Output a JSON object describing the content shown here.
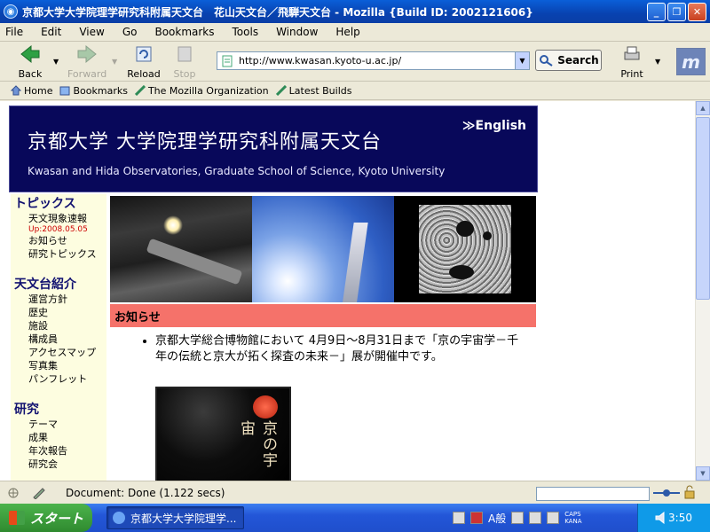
{
  "window": {
    "title": "京都大学大学院理学研究科附属天文台　花山天文台／飛騨天文台 - Mozilla {Build ID: 2002121606}",
    "buttons": [
      "_",
      "❐",
      "✕"
    ]
  },
  "menu": [
    "File",
    "Edit",
    "View",
    "Go",
    "Bookmarks",
    "Tools",
    "Window",
    "Help"
  ],
  "nav": {
    "back": "Back",
    "forward": "Forward",
    "reload": "Reload",
    "stop": "Stop",
    "url": "http://www.kwasan.kyoto-u.ac.jp/",
    "search": "Search",
    "print": "Print",
    "logo_letter": "m"
  },
  "personal_toolbar": [
    "Home",
    "Bookmarks",
    "The Mozilla Organization",
    "Latest Builds"
  ],
  "page": {
    "banner_jp": "京都大学 大学院理学研究科附属天文台",
    "banner_en": "Kwasan and Hida Observatories, Graduate School of Science, Kyoto University",
    "english_link": "≫English",
    "sidebar": [
      {
        "heading": "トピックス",
        "links": [
          "天文現象速報"
        ],
        "update": "Up:2008.05.05",
        "links2": [
          "お知らせ",
          "研究トピックス"
        ]
      },
      {
        "heading": "天文台紹介",
        "links": [
          "運営方針",
          "歴史",
          "施設",
          "構成員",
          "アクセスマップ",
          "写真集",
          "パンフレット"
        ]
      },
      {
        "heading": "研究",
        "links": [
          "テーマ",
          "成果",
          "年次報告",
          "研究会"
        ]
      }
    ],
    "news_heading": "お知らせ",
    "news_items": [
      "京都大学総合博物館において 4月9日～8月31日まで「京の宇宙学－千年の伝統と京大が拓く探査の未来－」展が開催中です。"
    ],
    "poster_text": "京の宇宙"
  },
  "status": {
    "message": "Document: Done (1.122 secs)"
  },
  "taskbar": {
    "start": "スタート",
    "task": "京都大学大学院理学...",
    "ime": "A般",
    "caps": "CAPS",
    "kana": "KANA",
    "clock": "3:50"
  }
}
